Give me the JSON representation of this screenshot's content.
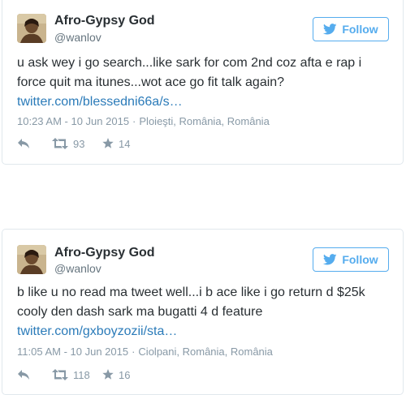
{
  "tweets": [
    {
      "author_name": "Afro-Gypsy God",
      "author_handle": "@wanlov",
      "follow_label": "Follow",
      "text_lines": [
        "u ask wey i go search...like sark for com 2nd coz afta e rap i",
        "force quit ma itunes...wot ace go fit talk again?"
      ],
      "link": "twitter.com/blessedni66a/s…",
      "timestamp": "10:23 AM - 10 Jun 2015",
      "location": "Ploieşti, România, România",
      "retweets": "93",
      "favorites": "14"
    },
    {
      "author_name": "Afro-Gypsy God",
      "author_handle": "@wanlov",
      "follow_label": "Follow",
      "text_lines": [
        "b like u no read ma tweet well...i b ace like i go return d $25k",
        "cooly den dash sark ma bugatti 4 d feature"
      ],
      "link": "twitter.com/gxboyzozii/sta…",
      "timestamp": "11:05 AM - 10 Jun 2015",
      "location": "Ciolpani, România, România",
      "retweets": "118",
      "favorites": "16"
    }
  ],
  "icons": {
    "follow": "twitter-bird-icon",
    "reply": "reply-icon",
    "retweet": "retweet-icon",
    "favorite": "star-icon"
  },
  "colors": {
    "accent": "#55acee",
    "link": "#2b7bb9",
    "text": "#292f33",
    "muted": "#8899a6",
    "border": "#e1e8ed"
  }
}
